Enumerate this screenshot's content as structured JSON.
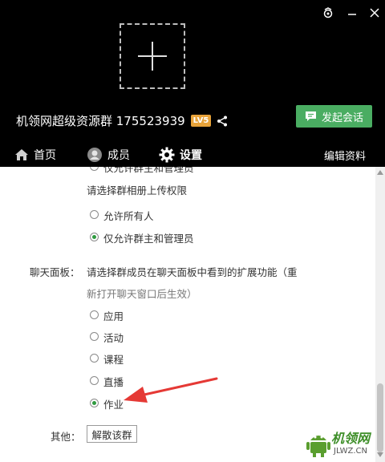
{
  "header": {
    "group_name": "机领网超级资源群 175523939",
    "level_badge": "LV5",
    "start_chat_label": "发起会话",
    "upload_icon": "plus-icon"
  },
  "nav": {
    "home": "首页",
    "members": "成员",
    "settings": "设置",
    "edit_profile": "编辑资料"
  },
  "settings": {
    "cut_option": "仅允许群主和管理员",
    "album_prompt": "请选择群相册上传权限",
    "album_options": [
      {
        "label": "允许所有人",
        "checked": false
      },
      {
        "label": "仅允许群主和管理员",
        "checked": true
      }
    ],
    "chat_panel_label": "聊天面板：",
    "chat_panel_desc_line1": "请选择群成员在聊天面板中看到的扩展功能（重",
    "chat_panel_desc_line2": "新打开聊天窗口后生效）",
    "chat_panel_options": [
      {
        "label": "应用",
        "checked": false
      },
      {
        "label": "活动",
        "checked": false
      },
      {
        "label": "课程",
        "checked": false
      },
      {
        "label": "直播",
        "checked": false
      },
      {
        "label": "作业",
        "checked": true
      }
    ],
    "other_label": "其他：",
    "disband_button": "解散该群"
  },
  "watermark": {
    "text": "机领网",
    "url": "JLWZ.CN"
  },
  "colors": {
    "header_bg": "#000000",
    "accent_green": "#4aad62",
    "badge_orange": "#e8a33a",
    "arrow_red": "#e53935"
  }
}
